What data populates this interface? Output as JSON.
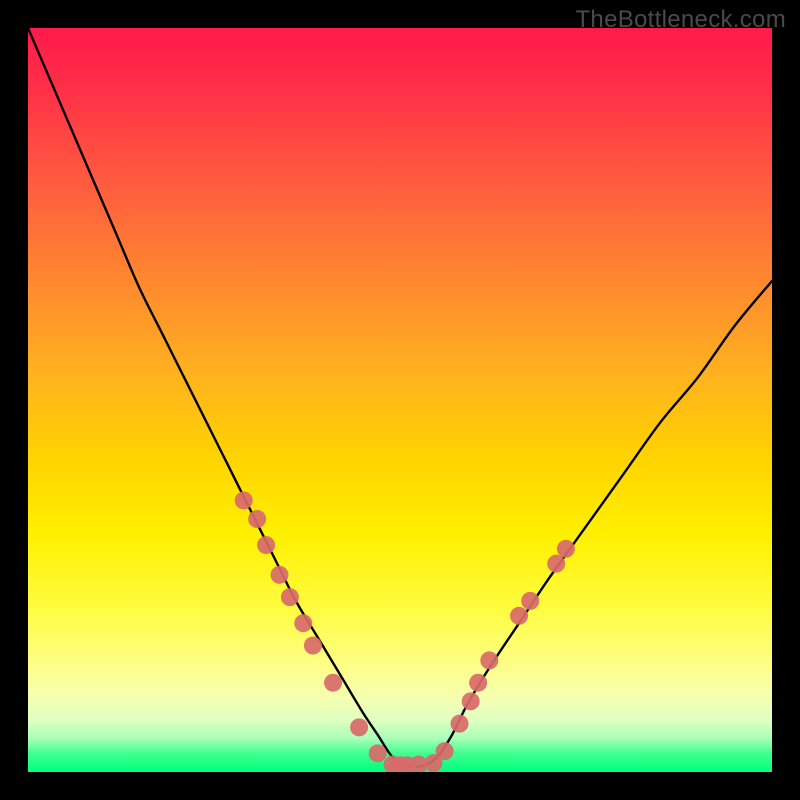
{
  "watermark": "TheBottleneck.com",
  "chart_data": {
    "type": "line",
    "title": "",
    "xlabel": "",
    "ylabel": "",
    "xlim": [
      0,
      100
    ],
    "ylim": [
      0,
      100
    ],
    "series": [
      {
        "name": "bottleneck-curve",
        "x": [
          0,
          3,
          6,
          9,
          12,
          15,
          18,
          21,
          24,
          27,
          30,
          33,
          36,
          39,
          42,
          45,
          47,
          49,
          51,
          53,
          55,
          57,
          59,
          62,
          66,
          70,
          75,
          80,
          85,
          90,
          95,
          100
        ],
        "values": [
          100,
          93,
          86,
          79,
          72,
          65,
          59,
          53,
          47,
          41,
          35,
          29,
          23,
          18,
          13,
          8,
          5,
          2,
          0.8,
          0.8,
          2,
          5,
          9,
          14,
          20,
          26,
          33,
          40,
          47,
          53,
          60,
          66
        ]
      }
    ],
    "markers": {
      "name": "sample-points",
      "color": "#d86a6a",
      "points": [
        {
          "x": 29.0,
          "y": 36.5
        },
        {
          "x": 30.8,
          "y": 34.0
        },
        {
          "x": 32.0,
          "y": 30.5
        },
        {
          "x": 33.8,
          "y": 26.5
        },
        {
          "x": 35.2,
          "y": 23.5
        },
        {
          "x": 37.0,
          "y": 20.0
        },
        {
          "x": 38.3,
          "y": 17.0
        },
        {
          "x": 41.0,
          "y": 12.0
        },
        {
          "x": 44.5,
          "y": 6.0
        },
        {
          "x": 47.0,
          "y": 2.5
        },
        {
          "x": 49.0,
          "y": 1.0
        },
        {
          "x": 50.0,
          "y": 0.9
        },
        {
          "x": 51.0,
          "y": 0.9
        },
        {
          "x": 52.5,
          "y": 1.0
        },
        {
          "x": 54.5,
          "y": 1.2
        },
        {
          "x": 56.0,
          "y": 2.8
        },
        {
          "x": 58.0,
          "y": 6.5
        },
        {
          "x": 59.5,
          "y": 9.5
        },
        {
          "x": 60.5,
          "y": 12.0
        },
        {
          "x": 62.0,
          "y": 15.0
        },
        {
          "x": 66.0,
          "y": 21.0
        },
        {
          "x": 67.5,
          "y": 23.0
        },
        {
          "x": 71.0,
          "y": 28.0
        },
        {
          "x": 72.3,
          "y": 30.0
        }
      ]
    },
    "gradient_stops": [
      {
        "pos": 0,
        "color": "#ff1a4a"
      },
      {
        "pos": 20,
        "color": "#ff5940"
      },
      {
        "pos": 46,
        "color": "#ffb020"
      },
      {
        "pos": 68,
        "color": "#fff000"
      },
      {
        "pos": 93,
        "color": "#e0ffc0"
      },
      {
        "pos": 100,
        "color": "#00ff7a"
      }
    ]
  }
}
